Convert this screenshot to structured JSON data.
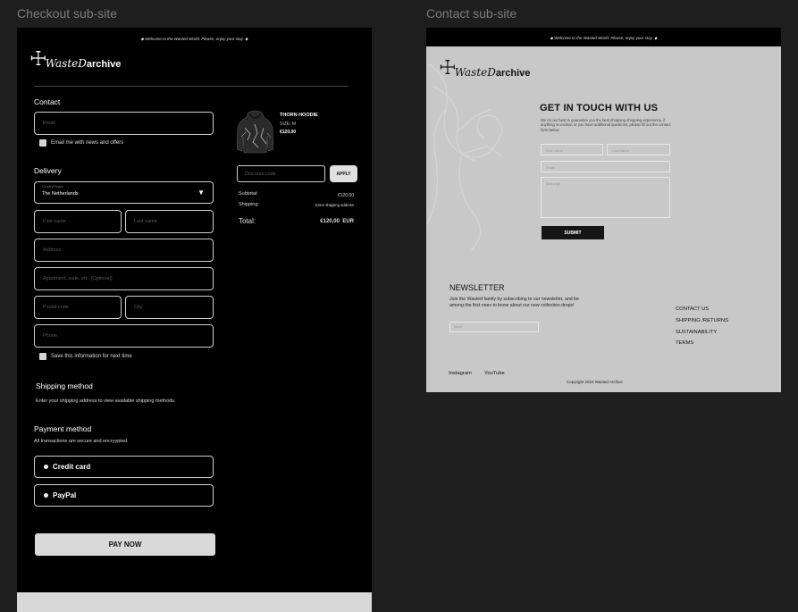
{
  "labels": {
    "checkout": "Checkout sub-site",
    "contact": "Contact sub-site"
  },
  "announcement": "◆ Welcome to the Wasted World. Please, enjoy your stay. ◆",
  "logo": {
    "script": "Waste",
    "letter": "D",
    "bold": "archive"
  },
  "checkout": {
    "contact_title": "Contact",
    "email_placeholder": "Email",
    "newsletter_check": "Email me with news and offers",
    "delivery_title": "Delivery",
    "country_label": "Country/Region",
    "country_value": "The Netherlands",
    "first_name": "First name",
    "last_name": "Last name",
    "address": "Address",
    "apartment": "Apartment, suite, etc. (Optional)",
    "postal": "Postal code",
    "city": "City",
    "phone": "Phone",
    "save_check": "Save this information for next time",
    "shipping_title": "Shipping method",
    "shipping_desc": "Enter your shipping address to view available shipping methods.",
    "payment_title": "Payment method",
    "payment_desc": "All transactions are secure and encryypted.",
    "payment_options": [
      "Credit card",
      "PayPal"
    ],
    "pay_button": "PAY NOW"
  },
  "summary": {
    "product_name": "THORN HOODIE",
    "product_size": "SIZE: M",
    "product_price": "€120,00",
    "discount_placeholder": "Discount code",
    "apply": "APPLY",
    "subtotal_label": "Subtotal:",
    "subtotal_value": "€120,00",
    "shipping_label": "Shipping:",
    "shipping_value": "Enter shipping address",
    "total_label": "Total:",
    "total_value": "€120,00  EUR"
  },
  "contact": {
    "title": "GET IN TOUCH WITH US",
    "desc": "We do our best to guarantee you the best shopping shopping experience, if anything is unclear, or you have additional questions, please fill out the contact form below.",
    "first_name": "First name",
    "last_name": "Last name",
    "email": "Email",
    "message": "Message",
    "submit": "SUBMIT",
    "newsletter_title": "NEWSLETTER",
    "newsletter_desc": "Join the Wasted family by subscribing to our newsletter, and be among the first ones to know about our new collection drops!",
    "newsletter_email": "Email",
    "links": [
      "CONTACT US",
      "SHIPPING /RETURNS",
      "SUSTAINABILITY",
      "TERMS"
    ],
    "social": [
      "Instagram",
      "YouTube"
    ],
    "copyright": "Copyright 2024 Wasted Archive"
  }
}
